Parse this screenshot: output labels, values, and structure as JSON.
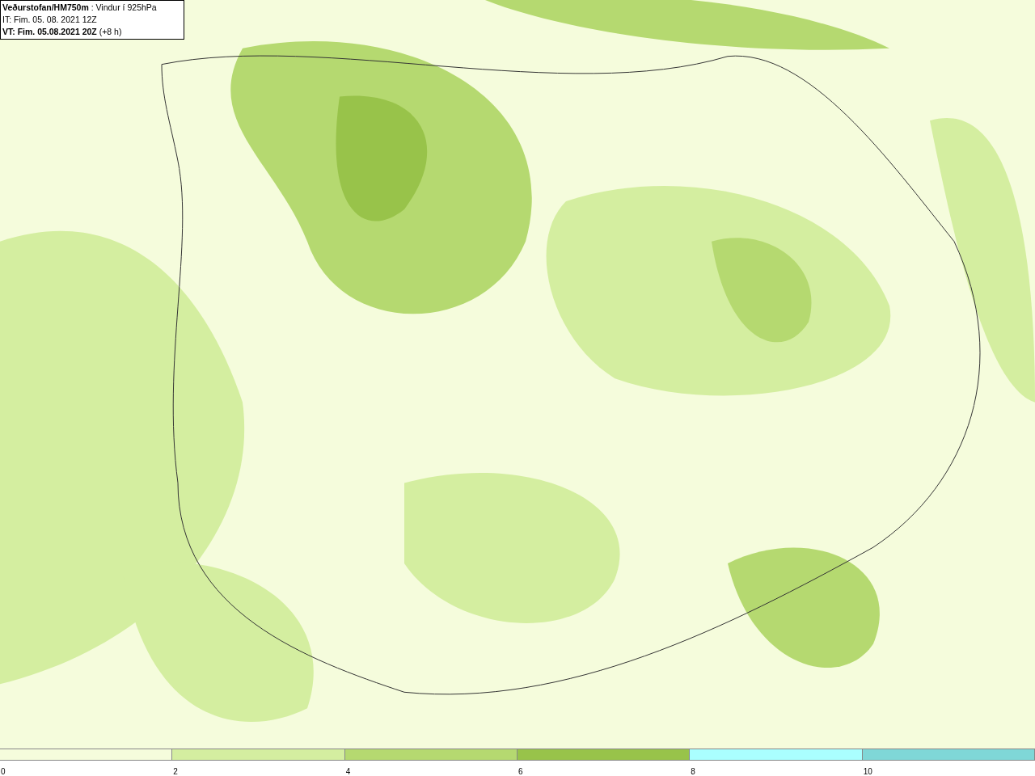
{
  "header": {
    "lines": [
      "**Veðurstofan/HM750m** : Vindur í 925hPa",
      "IT: Fim. 05. 08. 2021 12Z",
      "**VT: Fim. 05.08.2021 20Z** (+8 h)"
    ]
  },
  "legend": {
    "bins": [
      {
        "color": "#f5fcdc"
      },
      {
        "color": "#d4eea0"
      },
      {
        "color": "#b5d970"
      },
      {
        "color": "#98c34a"
      },
      {
        "color": "#aaffff"
      },
      {
        "color": "#7fd7d7"
      }
    ],
    "labels": [
      "0",
      "2",
      "4",
      "6",
      "8",
      "10"
    ]
  }
}
